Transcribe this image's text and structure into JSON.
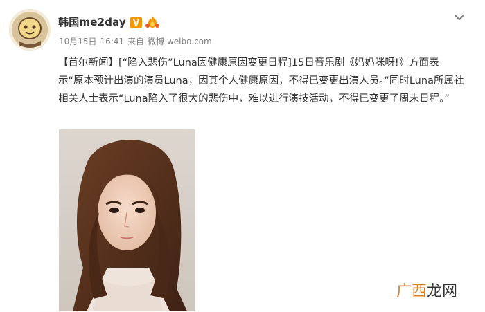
{
  "post": {
    "author": {
      "name": "韩国me2day",
      "verified_badge": "V",
      "avatar_icon": "cartoon-face-icon",
      "medal_icon": "fire-medal-icon"
    },
    "meta": {
      "date": "10月15日",
      "time": "16:41",
      "source_prefix": "来自",
      "source": "微博 weibo.com"
    },
    "text": {
      "p1": "【首尔新闻】[“陷入悲伤”Luna因健康原因变更日程]15日音乐剧《妈妈咪呀!》方面表示“原本预计出演的演员Luna，因其个人健康原因，不得已变更出演人员。”同时Luna所属社相关人士表示“Luna陷入了很大的悲伤中，难以进行演技活动，不得已变更了周末日程。”"
    },
    "menu_icon": "chevron-down-icon",
    "photo_alt": "woman-portrait-photo"
  },
  "watermark": {
    "part1": "广西",
    "part2": "龙网"
  },
  "colors": {
    "accent": "#eb7350",
    "verified": "#f39800",
    "meta": "#808080",
    "text": "#333333"
  }
}
